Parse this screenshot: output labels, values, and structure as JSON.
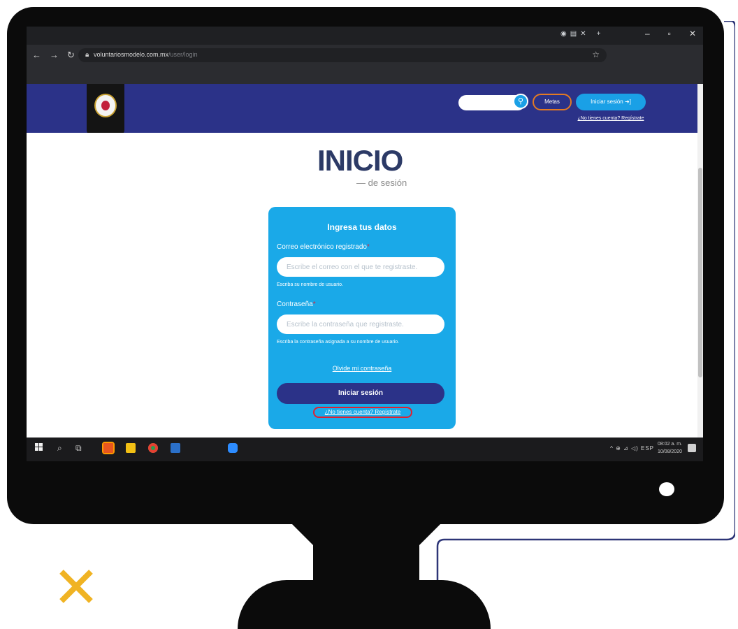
{
  "browser": {
    "url_host": "voluntariosmodelo.com.mx",
    "url_path": "/user/login"
  },
  "site": {
    "search_placeholder": "",
    "metas_label": "Metas",
    "login_button_label": "Iniciar sesión",
    "register_prompt": "¿No tienes cuenta? Regístrate"
  },
  "page": {
    "title": "INICIO",
    "subtitle": "— de sesión"
  },
  "form": {
    "heading": "Ingresa tus datos",
    "email_label": "Correo electrónico registrado",
    "email_placeholder": "Escribe el correo con el que te registraste.",
    "email_hint": "Escriba su nombre de usuario.",
    "password_label": "Contraseña",
    "password_placeholder": "Escribe la contraseña que registraste.",
    "password_hint": "Escriba la contraseña asignada a su nombre de usuario.",
    "forgot_link": "Olvide mi contraseña",
    "submit_label": "Iniciar sesión",
    "register_link": "¿No tienes cuenta? Regístrate",
    "required_mark": "*"
  },
  "taskbar": {
    "tray_text": "^ ⊕ ⊿ ◁) ESP",
    "time": "08:02 a. m.",
    "date": "10/08/2020"
  },
  "colors": {
    "site_header": "#2b3288",
    "card": "#1aa9e8",
    "accent_orange": "#e37a23",
    "highlight_red": "#e11f2f",
    "title": "#2c3a66",
    "x_mark": "#f0b323"
  }
}
